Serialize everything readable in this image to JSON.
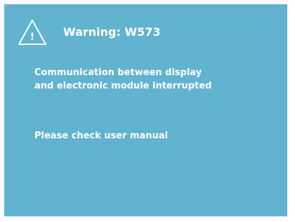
{
  "dialog": {
    "icon": "warning-triangle-icon",
    "icon_glyph": "!",
    "title": "Warning: W573",
    "message_line1": "Communication between display",
    "message_line2": "and electronic module interrupted",
    "instruction": "Please check user manual"
  },
  "colors": {
    "background": "#62b3d0",
    "text": "#ffffff"
  }
}
